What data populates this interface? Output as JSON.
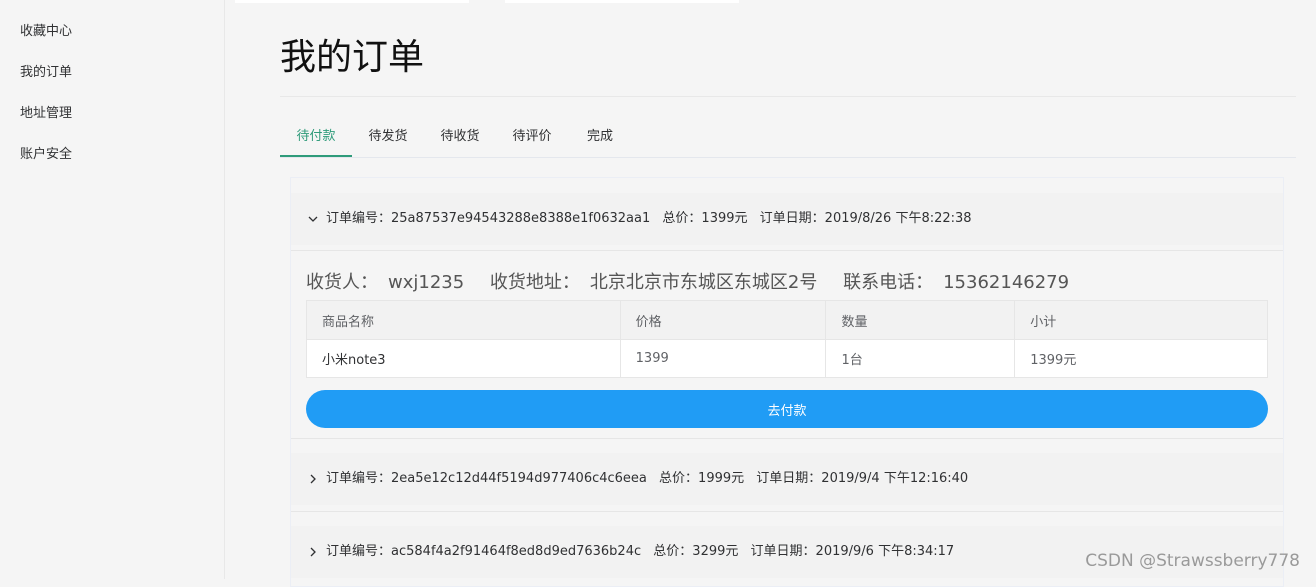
{
  "sidebar": {
    "items": [
      {
        "label": "收藏中心"
      },
      {
        "label": "我的订单"
      },
      {
        "label": "地址管理"
      },
      {
        "label": "账户安全"
      }
    ]
  },
  "page": {
    "title": "我的订单"
  },
  "tabs": [
    {
      "label": "待付款",
      "active": true
    },
    {
      "label": "待发货",
      "active": false
    },
    {
      "label": "待收货",
      "active": false
    },
    {
      "label": "待评价",
      "active": false
    },
    {
      "label": "完成",
      "active": false
    }
  ],
  "orders": [
    {
      "expanded": true,
      "arrow": "chevron-down-icon",
      "number_label": "订单编号：",
      "number": "25a87537e94543288e8388e1f0632aa1",
      "total_label": "总价：",
      "total": "1399元",
      "date_label": "订单日期：",
      "date": "2019/8/26 下午8:22:38",
      "receiver_label": "收货人：",
      "receiver": "wxj1235",
      "address_label": "收货地址：",
      "address": "北京北京市东城区东城区2号",
      "phone_label": "联系电话：",
      "phone": "15362146279",
      "table": {
        "headers": [
          "商品名称",
          "价格",
          "数量",
          "小计"
        ],
        "rows": [
          [
            "小米note3",
            "1399",
            "1台",
            "1399元"
          ]
        ]
      },
      "pay_button": "去付款"
    },
    {
      "expanded": false,
      "arrow": "chevron-right-icon",
      "number_label": "订单编号：",
      "number": "2ea5e12c12d44f5194d977406c4c6eea",
      "total_label": "总价：",
      "total": "1999元",
      "date_label": "订单日期：",
      "date": "2019/9/4 下午12:16:40"
    },
    {
      "expanded": false,
      "arrow": "chevron-right-icon",
      "number_label": "订单编号：",
      "number": "ac584f4a2f91464f8ed8d9ed7636b24c",
      "total_label": "总价：",
      "total": "3299元",
      "date_label": "订单日期：",
      "date": "2019/9/6 下午8:34:17"
    }
  ],
  "colors": {
    "accent": "#2f9b7a",
    "primary_button": "#209cf5",
    "background": "#f5f5f5"
  },
  "watermark": "CSDN @Strawssberry778"
}
